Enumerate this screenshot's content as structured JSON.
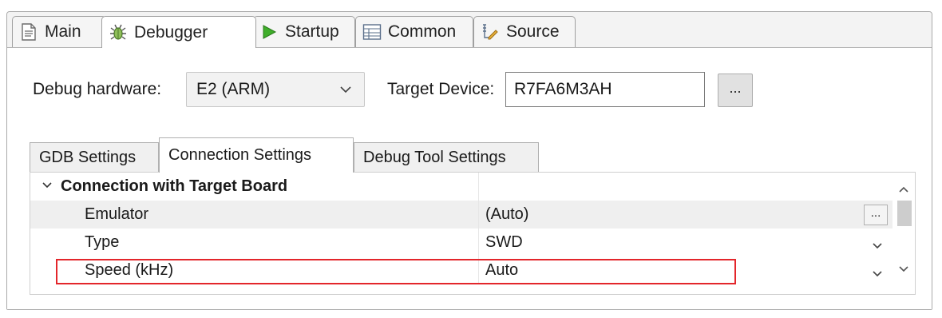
{
  "tabs": [
    {
      "label": "Main",
      "icon": "main-page-icon",
      "active": false
    },
    {
      "label": "Debugger",
      "icon": "debugger-bug-icon",
      "active": true
    },
    {
      "label": "Startup",
      "icon": "startup-play-icon",
      "active": false
    },
    {
      "label": "Common",
      "icon": "common-grid-icon",
      "active": false
    },
    {
      "label": "Source",
      "icon": "source-lookup-icon",
      "active": false
    }
  ],
  "debug_hardware": {
    "label": "Debug hardware:",
    "value": "E2 (ARM)"
  },
  "target_device": {
    "label": "Target Device:",
    "value": "R7FA6M3AH",
    "browse_label": "..."
  },
  "subtabs": [
    {
      "label": "GDB Settings",
      "active": false
    },
    {
      "label": "Connection Settings",
      "active": true
    },
    {
      "label": "Debug Tool Settings",
      "active": false
    }
  ],
  "table": {
    "group": {
      "label": "Connection with Target Board",
      "value": ""
    },
    "rows": [
      {
        "name": "Emulator",
        "value": "(Auto)",
        "control": "browse",
        "control_label": "..."
      },
      {
        "name": "Type",
        "value": "SWD",
        "control": "dropdown"
      },
      {
        "name": "Speed (kHz)",
        "value": "Auto",
        "control": "dropdown"
      }
    ]
  },
  "colors": {
    "highlight": "#e3262b",
    "startup_icon": "#3fae2a",
    "selected_row": "#efefef"
  }
}
